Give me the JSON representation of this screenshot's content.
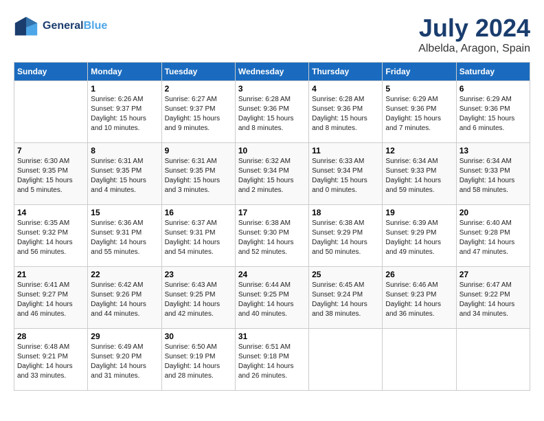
{
  "header": {
    "logo_text_general": "General",
    "logo_text_blue": "Blue",
    "month_title": "July 2024",
    "location": "Albelda, Aragon, Spain"
  },
  "days_of_week": [
    "Sunday",
    "Monday",
    "Tuesday",
    "Wednesday",
    "Thursday",
    "Friday",
    "Saturday"
  ],
  "weeks": [
    [
      {
        "day": "",
        "sunrise": "",
        "sunset": "",
        "daylight": ""
      },
      {
        "day": "1",
        "sunrise": "Sunrise: 6:26 AM",
        "sunset": "Sunset: 9:37 PM",
        "daylight": "Daylight: 15 hours and 10 minutes."
      },
      {
        "day": "2",
        "sunrise": "Sunrise: 6:27 AM",
        "sunset": "Sunset: 9:37 PM",
        "daylight": "Daylight: 15 hours and 9 minutes."
      },
      {
        "day": "3",
        "sunrise": "Sunrise: 6:28 AM",
        "sunset": "Sunset: 9:36 PM",
        "daylight": "Daylight: 15 hours and 8 minutes."
      },
      {
        "day": "4",
        "sunrise": "Sunrise: 6:28 AM",
        "sunset": "Sunset: 9:36 PM",
        "daylight": "Daylight: 15 hours and 8 minutes."
      },
      {
        "day": "5",
        "sunrise": "Sunrise: 6:29 AM",
        "sunset": "Sunset: 9:36 PM",
        "daylight": "Daylight: 15 hours and 7 minutes."
      },
      {
        "day": "6",
        "sunrise": "Sunrise: 6:29 AM",
        "sunset": "Sunset: 9:36 PM",
        "daylight": "Daylight: 15 hours and 6 minutes."
      }
    ],
    [
      {
        "day": "7",
        "sunrise": "Sunrise: 6:30 AM",
        "sunset": "Sunset: 9:35 PM",
        "daylight": "Daylight: 15 hours and 5 minutes."
      },
      {
        "day": "8",
        "sunrise": "Sunrise: 6:31 AM",
        "sunset": "Sunset: 9:35 PM",
        "daylight": "Daylight: 15 hours and 4 minutes."
      },
      {
        "day": "9",
        "sunrise": "Sunrise: 6:31 AM",
        "sunset": "Sunset: 9:35 PM",
        "daylight": "Daylight: 15 hours and 3 minutes."
      },
      {
        "day": "10",
        "sunrise": "Sunrise: 6:32 AM",
        "sunset": "Sunset: 9:34 PM",
        "daylight": "Daylight: 15 hours and 2 minutes."
      },
      {
        "day": "11",
        "sunrise": "Sunrise: 6:33 AM",
        "sunset": "Sunset: 9:34 PM",
        "daylight": "Daylight: 15 hours and 0 minutes."
      },
      {
        "day": "12",
        "sunrise": "Sunrise: 6:34 AM",
        "sunset": "Sunset: 9:33 PM",
        "daylight": "Daylight: 14 hours and 59 minutes."
      },
      {
        "day": "13",
        "sunrise": "Sunrise: 6:34 AM",
        "sunset": "Sunset: 9:33 PM",
        "daylight": "Daylight: 14 hours and 58 minutes."
      }
    ],
    [
      {
        "day": "14",
        "sunrise": "Sunrise: 6:35 AM",
        "sunset": "Sunset: 9:32 PM",
        "daylight": "Daylight: 14 hours and 56 minutes."
      },
      {
        "day": "15",
        "sunrise": "Sunrise: 6:36 AM",
        "sunset": "Sunset: 9:31 PM",
        "daylight": "Daylight: 14 hours and 55 minutes."
      },
      {
        "day": "16",
        "sunrise": "Sunrise: 6:37 AM",
        "sunset": "Sunset: 9:31 PM",
        "daylight": "Daylight: 14 hours and 54 minutes."
      },
      {
        "day": "17",
        "sunrise": "Sunrise: 6:38 AM",
        "sunset": "Sunset: 9:30 PM",
        "daylight": "Daylight: 14 hours and 52 minutes."
      },
      {
        "day": "18",
        "sunrise": "Sunrise: 6:38 AM",
        "sunset": "Sunset: 9:29 PM",
        "daylight": "Daylight: 14 hours and 50 minutes."
      },
      {
        "day": "19",
        "sunrise": "Sunrise: 6:39 AM",
        "sunset": "Sunset: 9:29 PM",
        "daylight": "Daylight: 14 hours and 49 minutes."
      },
      {
        "day": "20",
        "sunrise": "Sunrise: 6:40 AM",
        "sunset": "Sunset: 9:28 PM",
        "daylight": "Daylight: 14 hours and 47 minutes."
      }
    ],
    [
      {
        "day": "21",
        "sunrise": "Sunrise: 6:41 AM",
        "sunset": "Sunset: 9:27 PM",
        "daylight": "Daylight: 14 hours and 46 minutes."
      },
      {
        "day": "22",
        "sunrise": "Sunrise: 6:42 AM",
        "sunset": "Sunset: 9:26 PM",
        "daylight": "Daylight: 14 hours and 44 minutes."
      },
      {
        "day": "23",
        "sunrise": "Sunrise: 6:43 AM",
        "sunset": "Sunset: 9:25 PM",
        "daylight": "Daylight: 14 hours and 42 minutes."
      },
      {
        "day": "24",
        "sunrise": "Sunrise: 6:44 AM",
        "sunset": "Sunset: 9:25 PM",
        "daylight": "Daylight: 14 hours and 40 minutes."
      },
      {
        "day": "25",
        "sunrise": "Sunrise: 6:45 AM",
        "sunset": "Sunset: 9:24 PM",
        "daylight": "Daylight: 14 hours and 38 minutes."
      },
      {
        "day": "26",
        "sunrise": "Sunrise: 6:46 AM",
        "sunset": "Sunset: 9:23 PM",
        "daylight": "Daylight: 14 hours and 36 minutes."
      },
      {
        "day": "27",
        "sunrise": "Sunrise: 6:47 AM",
        "sunset": "Sunset: 9:22 PM",
        "daylight": "Daylight: 14 hours and 34 minutes."
      }
    ],
    [
      {
        "day": "28",
        "sunrise": "Sunrise: 6:48 AM",
        "sunset": "Sunset: 9:21 PM",
        "daylight": "Daylight: 14 hours and 33 minutes."
      },
      {
        "day": "29",
        "sunrise": "Sunrise: 6:49 AM",
        "sunset": "Sunset: 9:20 PM",
        "daylight": "Daylight: 14 hours and 31 minutes."
      },
      {
        "day": "30",
        "sunrise": "Sunrise: 6:50 AM",
        "sunset": "Sunset: 9:19 PM",
        "daylight": "Daylight: 14 hours and 28 minutes."
      },
      {
        "day": "31",
        "sunrise": "Sunrise: 6:51 AM",
        "sunset": "Sunset: 9:18 PM",
        "daylight": "Daylight: 14 hours and 26 minutes."
      },
      {
        "day": "",
        "sunrise": "",
        "sunset": "",
        "daylight": ""
      },
      {
        "day": "",
        "sunrise": "",
        "sunset": "",
        "daylight": ""
      },
      {
        "day": "",
        "sunrise": "",
        "sunset": "",
        "daylight": ""
      }
    ]
  ]
}
